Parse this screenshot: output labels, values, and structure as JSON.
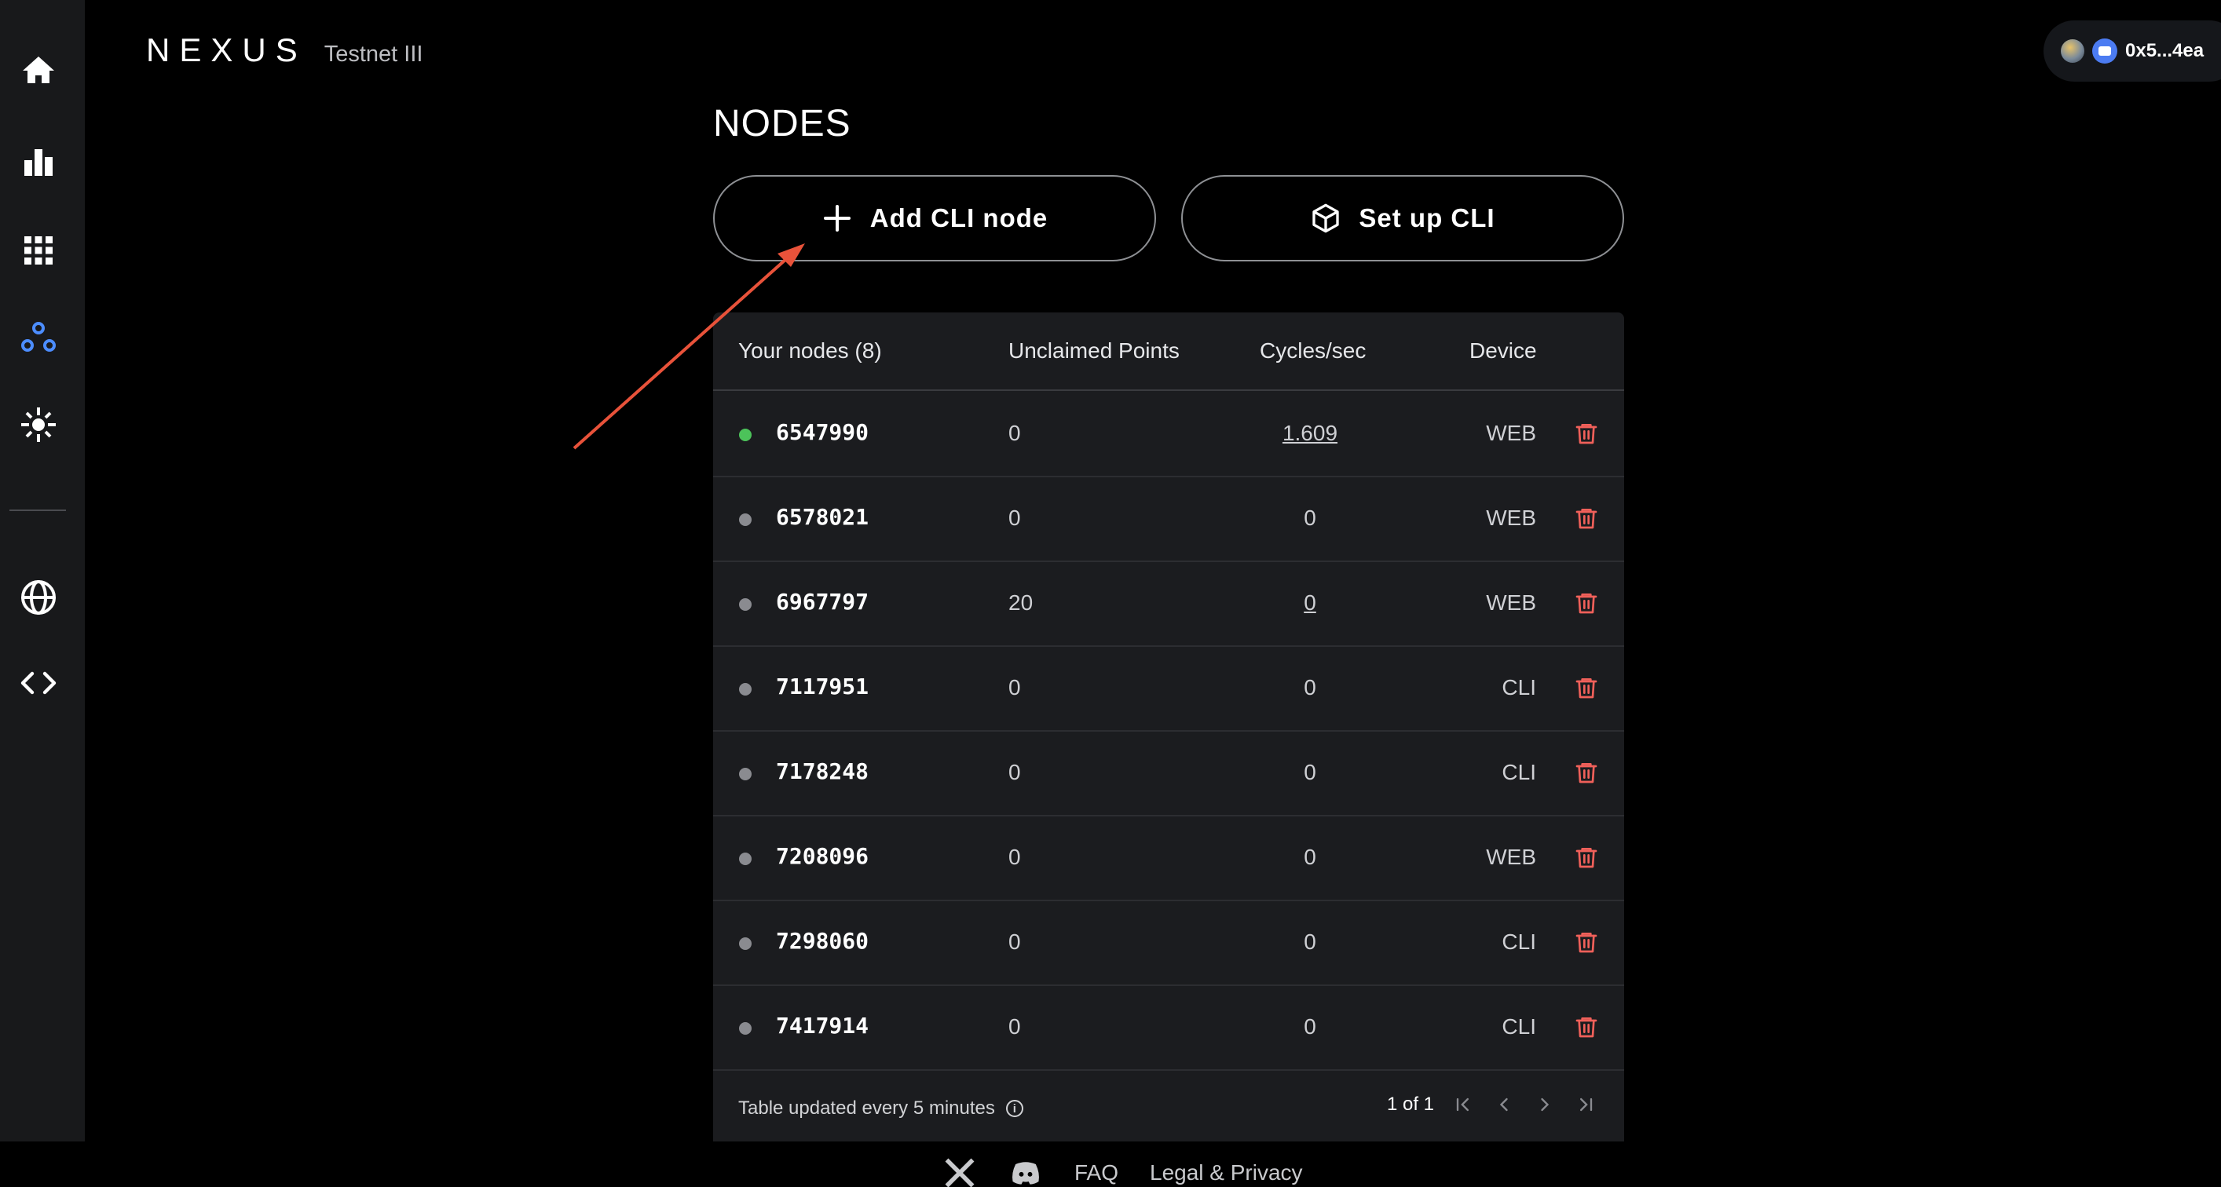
{
  "header": {
    "logo": "NEXUS",
    "network": "Testnet III"
  },
  "wallet": {
    "address": "0x5...4ea"
  },
  "sidebar": {
    "items": [
      {
        "icon": "home-icon"
      },
      {
        "icon": "bar-chart-icon"
      },
      {
        "icon": "grid-icon"
      },
      {
        "icon": "nodes-icon",
        "active": true
      },
      {
        "icon": "sparkle-icon"
      },
      {
        "icon": "globe-icon"
      },
      {
        "icon": "code-icon"
      }
    ],
    "active_color": "#4c8dff"
  },
  "main": {
    "title": "NODES",
    "add_button": "Add CLI node",
    "setup_button": "Set up CLI"
  },
  "table": {
    "headers": {
      "nodes": "Your nodes (8)",
      "points": "Unclaimed Points",
      "cycles": "Cycles/sec",
      "device": "Device"
    },
    "rows": [
      {
        "id": "6547990",
        "points": "0",
        "cycles": "1.609",
        "device": "WEB",
        "online": true
      },
      {
        "id": "6578021",
        "points": "0",
        "cycles": "0",
        "device": "WEB",
        "online": false
      },
      {
        "id": "6967797",
        "points": "20",
        "cycles": "0",
        "device": "WEB",
        "online": false
      },
      {
        "id": "7117951",
        "points": "0",
        "cycles": "0",
        "device": "CLI",
        "online": false
      },
      {
        "id": "7178248",
        "points": "0",
        "cycles": "0",
        "device": "CLI",
        "online": false
      },
      {
        "id": "7208096",
        "points": "0",
        "cycles": "0",
        "device": "WEB",
        "online": false
      },
      {
        "id": "7298060",
        "points": "0",
        "cycles": "0",
        "device": "CLI",
        "online": false
      },
      {
        "id": "7417914",
        "points": "0",
        "cycles": "0",
        "device": "CLI",
        "online": false
      }
    ],
    "footer_note": "Table updated every 5 minutes",
    "page_indicator": "1 of 1",
    "status_colors": {
      "online": "#4cc35a",
      "offline": "#8a8b90"
    },
    "delete_color": "#f0605a"
  },
  "footer": {
    "faq": "FAQ",
    "legal": "Legal & Privacy"
  },
  "annotation_color": "#e8523a"
}
